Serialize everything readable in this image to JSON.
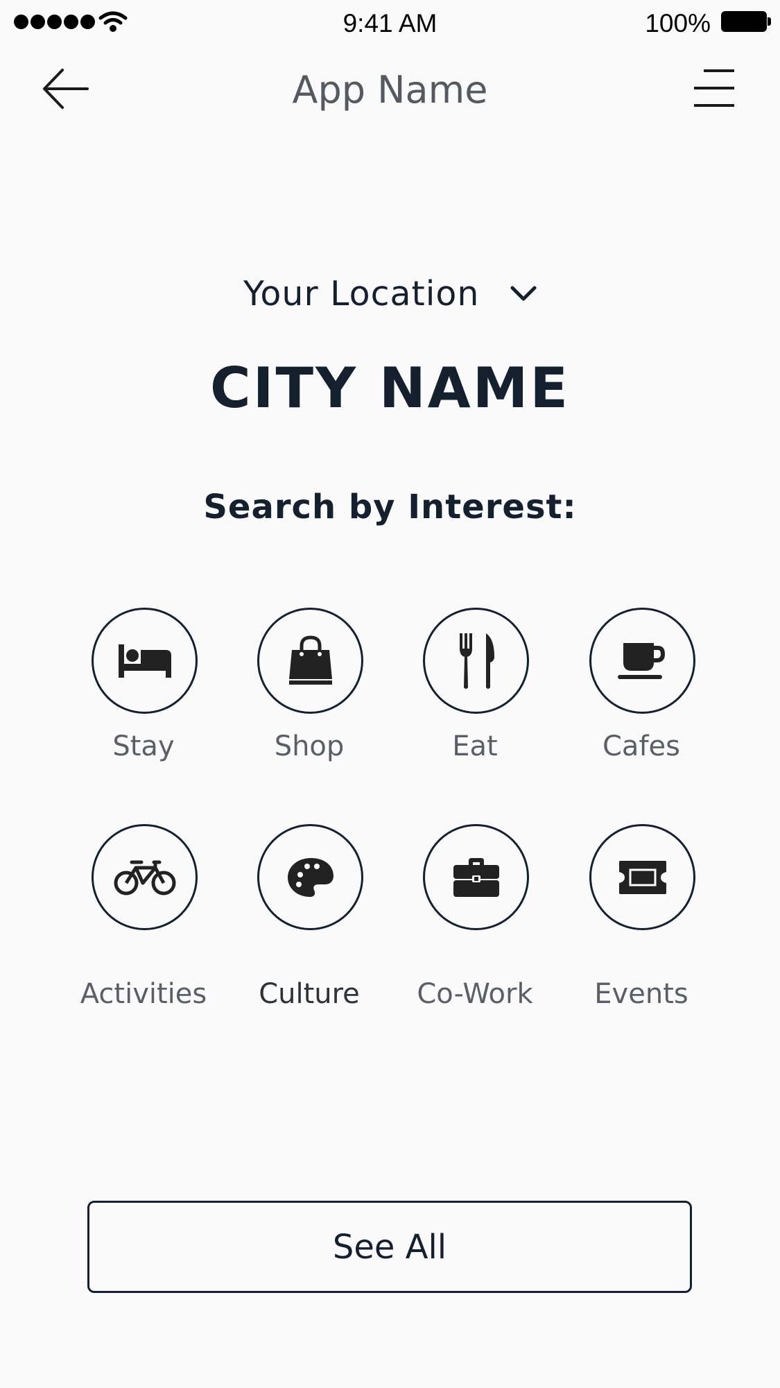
{
  "status_bar": {
    "time": "9:41 AM",
    "battery": "100%",
    "signal_icon": "signal-dots-icon",
    "wifi_icon": "wifi-icon",
    "battery_icon": "battery-icon"
  },
  "nav": {
    "title": "App Name",
    "back_icon": "arrow-left-icon",
    "menu_icon": "menu-icon"
  },
  "location": {
    "label": "Your Location",
    "dropdown_icon": "chevron-down-icon",
    "city": "CITY NAME"
  },
  "search_heading": "Search by Interest:",
  "interests": [
    {
      "label": "Stay",
      "icon": "bed-icon"
    },
    {
      "label": "Shop",
      "icon": "shopping-bag-icon"
    },
    {
      "label": "Eat",
      "icon": "fork-knife-icon"
    },
    {
      "label": "Cafes",
      "icon": "coffee-cup-icon"
    },
    {
      "label": "Activities",
      "icon": "bicycle-icon"
    },
    {
      "label": "Culture",
      "icon": "palette-icon"
    },
    {
      "label": "Co-Work",
      "icon": "briefcase-icon"
    },
    {
      "label": "Events",
      "icon": "ticket-icon"
    }
  ],
  "see_all_label": "See All",
  "colors": {
    "background": "#fafafb",
    "primary": "#14202e",
    "muted_text": "#5a5f66"
  }
}
